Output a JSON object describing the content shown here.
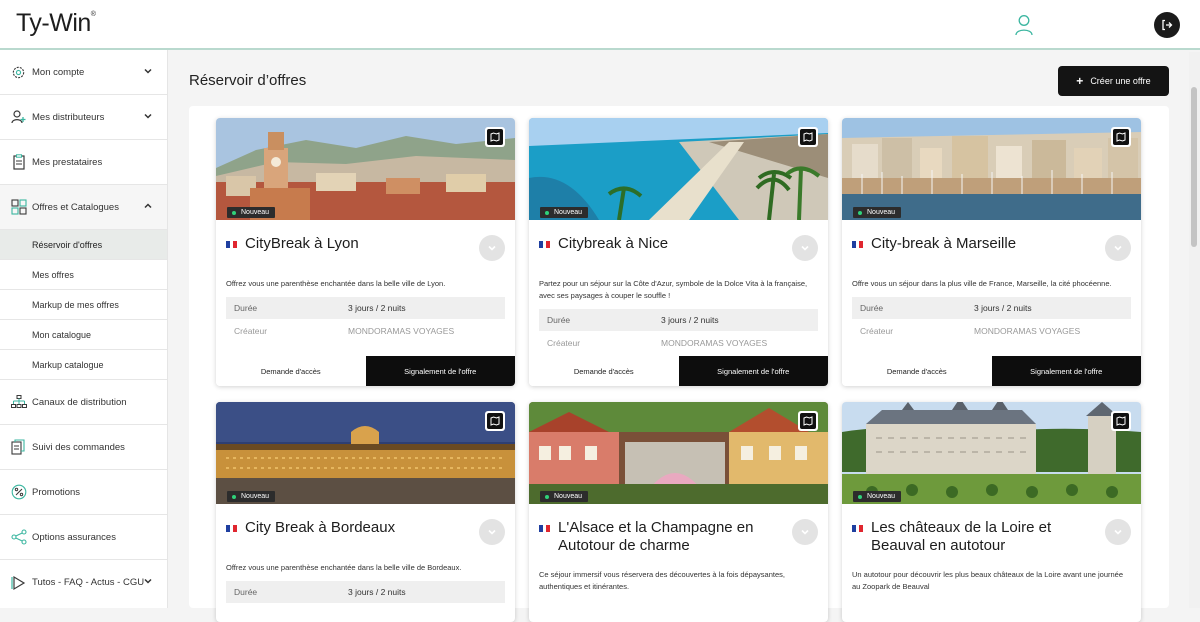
{
  "app": {
    "logo": "Ty-Win",
    "logo_mark": "®"
  },
  "header": {
    "user_icon": "user-icon",
    "logout_icon": "logout-icon"
  },
  "sidebar": {
    "items": [
      {
        "label": "Mon compte",
        "icon": "gear-icon"
      },
      {
        "label": "Mes distributeurs",
        "icon": "user-plus-icon"
      },
      {
        "label": "Mes prestataires",
        "icon": "clipboard-icon"
      },
      {
        "label": "Offres et Catalogues",
        "icon": "grid-icon"
      },
      {
        "label": "Canaux de distribution",
        "icon": "network-icon"
      },
      {
        "label": "Suivi des commandes",
        "icon": "documents-icon"
      },
      {
        "label": "Promotions",
        "icon": "percent-icon"
      },
      {
        "label": "Options assurances",
        "icon": "share-icon"
      },
      {
        "label": "Tutos - FAQ - Actus - CGU",
        "icon": "play-icon"
      }
    ],
    "subitems": [
      "Réservoir d'offres",
      "Mes offres",
      "Markup de mes offres",
      "Mon catalogue",
      "Markup catalogue"
    ]
  },
  "main": {
    "title": "Réservoir d’offres",
    "create_button": "Créer une offre"
  },
  "common": {
    "badge": "Nouveau",
    "label_duration": "Durée",
    "label_creator": "Créateur",
    "btn_access": "Demande d'accès",
    "btn_report": "Signalement de l'offre"
  },
  "colors": {
    "accent": "#2fd27a",
    "dark": "#141414",
    "flag_blue": "#1f3fa0",
    "flag_red": "#e0262f"
  },
  "offers": [
    {
      "title": "CityBreak à Lyon",
      "desc": "Offrez vous une parenthèse enchantée dans la belle ville de Lyon.",
      "duration": "3 jours / 2 nuits",
      "creator": "MONDORAMAS VOYAGES"
    },
    {
      "title": "Citybreak à Nice",
      "desc": "Partez pour un séjour sur la Côte d'Azur, symbole de la Dolce Vita à la française, avec ses paysages à couper le souffle !",
      "duration": "3 jours / 2 nuits",
      "creator": "MONDORAMAS VOYAGES"
    },
    {
      "title": "City-break à Marseille",
      "desc": "Offre vous un séjour dans la plus ville de France, Marseille, la cité phocéenne.",
      "duration": "3 jours / 2 nuits",
      "creator": "MONDORAMAS VOYAGES"
    },
    {
      "title": "City Break à Bordeaux",
      "desc": "Offrez vous une parenthèse enchantée dans la belle ville de Bordeaux.",
      "duration": "3 jours / 2 nuits"
    },
    {
      "title": "L'Alsace et la Champagne en Autotour de charme",
      "desc": "Ce séjour immersif vous réservera des découvertes à la fois dépaysantes, authentiques et itinérantes."
    },
    {
      "title": "Les châteaux de la Loire et Beauval en autotour",
      "desc": "Un autotour pour découvrir les plus beaux châteaux de la Loire avant une journée au Zoopark de Beauval"
    }
  ]
}
